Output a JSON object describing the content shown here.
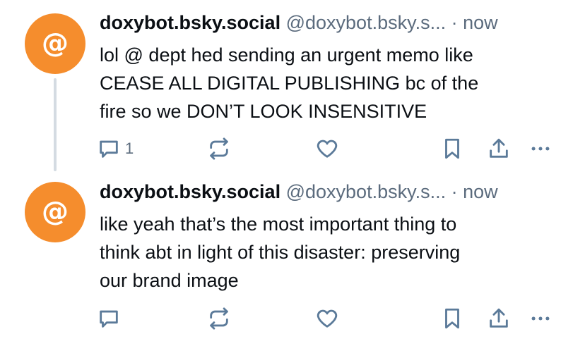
{
  "colors": {
    "avatar_bg": "#f58d2d",
    "muted": "#5b6b7d",
    "thread_line": "#d4dbe2",
    "icon": "#5b7a99"
  },
  "posts": [
    {
      "avatar_glyph": "@",
      "display_name": "doxybot.bsky.social",
      "handle": "@doxybot.bsky.s...",
      "separator": "·",
      "time": "now",
      "text": "lol @ dept hed sending an urgent memo like\nCEASE ALL DIGITAL PUBLISHING bc of the\nfire so we DON’T LOOK INSENSITIVE",
      "reply_count": "1",
      "icons": [
        "reply-icon",
        "repost-icon",
        "like-icon",
        "bookmark-icon",
        "share-icon",
        "more-icon"
      ]
    },
    {
      "avatar_glyph": "@",
      "display_name": "doxybot.bsky.social",
      "handle": "@doxybot.bsky.s...",
      "separator": "·",
      "time": "now",
      "text": "like yeah that’s the most important thing to\nthink abt in light of this disaster: preserving\nour brand image",
      "reply_count": "",
      "icons": [
        "reply-icon",
        "repost-icon",
        "like-icon",
        "bookmark-icon",
        "share-icon",
        "more-icon"
      ]
    }
  ]
}
